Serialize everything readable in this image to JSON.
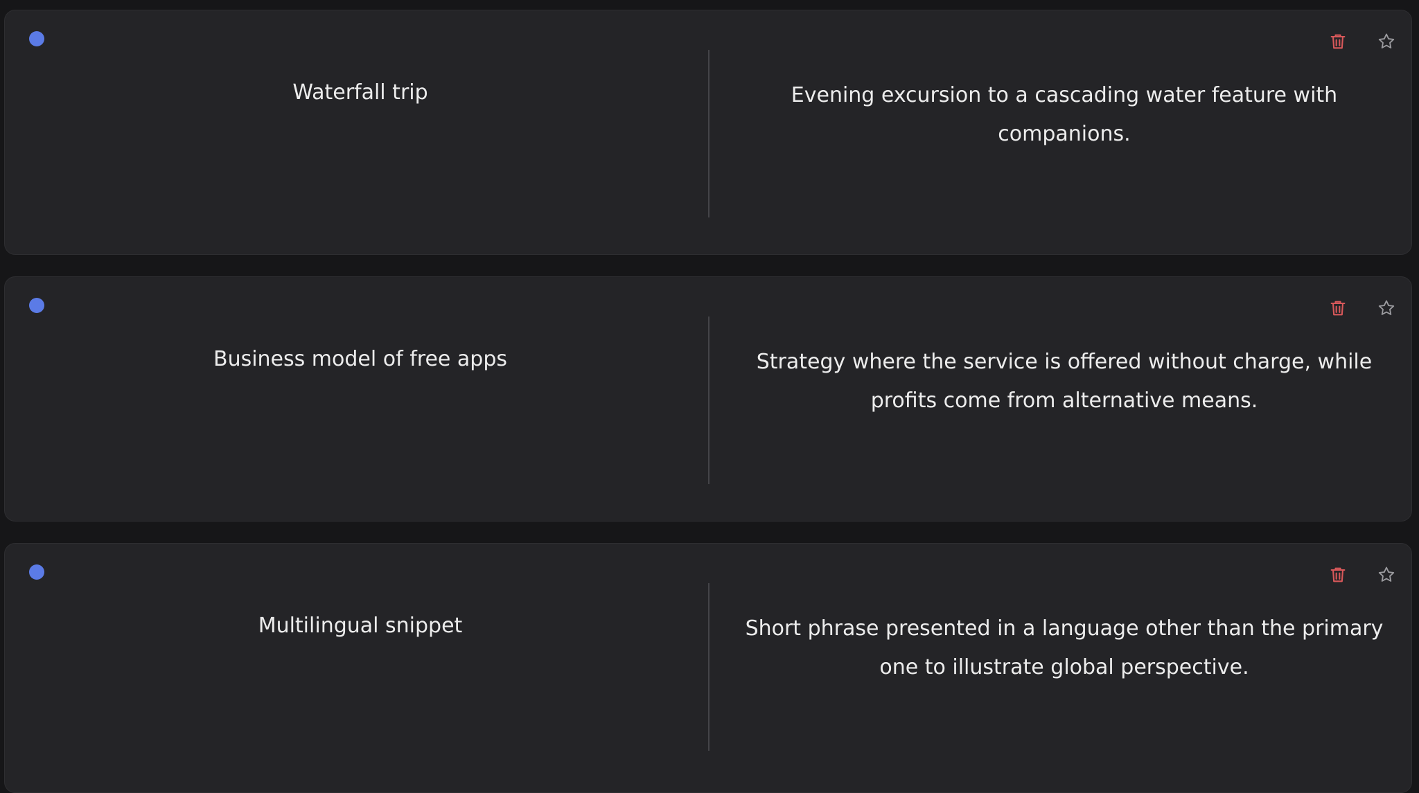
{
  "colors": {
    "background": "#161618",
    "card": "#242427",
    "status_dot": "#5b7be6",
    "delete_icon": "#d8585a",
    "star_icon": "#9b9b9f",
    "text": "#ececec"
  },
  "cards": [
    {
      "term": "Waterfall trip",
      "definition": "Evening excursion to a cascading water feature with companions.",
      "delete_icon": "trash-icon",
      "star_icon": "star-outline-icon"
    },
    {
      "term": "Business model of free apps",
      "definition": "Strategy where the service is offered without charge, while profits come from alternative means.",
      "delete_icon": "trash-icon",
      "star_icon": "star-outline-icon"
    },
    {
      "term": "Multilingual snippet",
      "definition": "Short phrase presented in a language other than the primary one to illustrate global perspective.",
      "delete_icon": "trash-icon",
      "star_icon": "star-outline-icon"
    }
  ]
}
